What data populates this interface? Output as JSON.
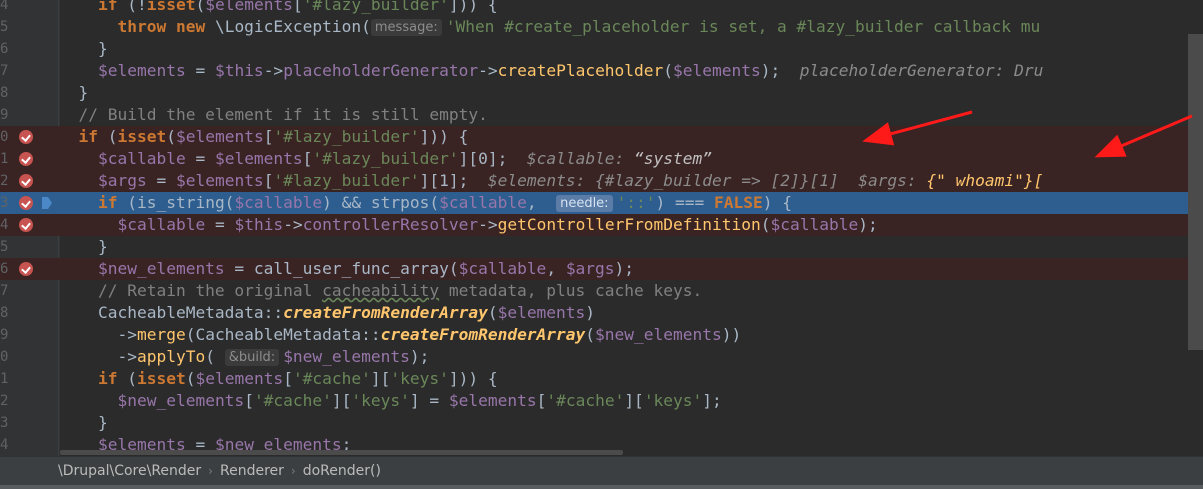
{
  "editor": {
    "lines": [
      {
        "num": "4",
        "bp": false,
        "cur": false,
        "tokens": [
          {
            "c": "com",
            "t": "    "
          },
          {
            "c": "kw",
            "t": "if"
          },
          {
            "c": "",
            "t": " (!"
          },
          {
            "c": "kw",
            "t": "isset"
          },
          {
            "c": "",
            "t": "("
          },
          {
            "c": "var",
            "t": "$elements"
          },
          {
            "c": "",
            "t": "["
          },
          {
            "c": "str",
            "t": "'#lazy_builder'"
          },
          {
            "c": "",
            "t": "])) {"
          }
        ]
      },
      {
        "num": "5",
        "bp": false,
        "cur": false,
        "tokens": [
          {
            "c": "",
            "t": "      "
          },
          {
            "c": "kw",
            "t": "throw new"
          },
          {
            "c": "",
            "t": " \\LogicException("
          },
          {
            "c": "hint",
            "t": "message:"
          },
          {
            "c": "str",
            "t": "'When #create_placeholder is set, a #lazy_builder callback mu"
          }
        ]
      },
      {
        "num": "6",
        "bp": false,
        "cur": false,
        "tokens": [
          {
            "c": "",
            "t": "    }"
          }
        ]
      },
      {
        "num": "7",
        "bp": false,
        "cur": false,
        "tokens": [
          {
            "c": "",
            "t": "    "
          },
          {
            "c": "var",
            "t": "$elements"
          },
          {
            "c": "",
            "t": " = "
          },
          {
            "c": "var",
            "t": "$this"
          },
          {
            "c": "",
            "t": "->"
          },
          {
            "c": "var",
            "t": "placeholderGenerator"
          },
          {
            "c": "",
            "t": "->"
          },
          {
            "c": "fn",
            "t": "createPlaceholder"
          },
          {
            "c": "",
            "t": "("
          },
          {
            "c": "var",
            "t": "$elements"
          },
          {
            "c": "",
            "t": ");  "
          },
          {
            "c": "dbg",
            "t": "placeholderGenerator: Dru"
          }
        ]
      },
      {
        "num": "8",
        "bp": false,
        "cur": false,
        "tokens": [
          {
            "c": "",
            "t": "  }"
          }
        ]
      },
      {
        "num": "9",
        "bp": false,
        "cur": false,
        "tokens": [
          {
            "c": "com",
            "t": "  // Build the element if it is still empty."
          }
        ]
      },
      {
        "num": "0",
        "bp": true,
        "cur": false,
        "tokens": [
          {
            "c": "",
            "t": "  "
          },
          {
            "c": "kw",
            "t": "if"
          },
          {
            "c": "",
            "t": " ("
          },
          {
            "c": "kw",
            "t": "isset"
          },
          {
            "c": "",
            "t": "("
          },
          {
            "c": "var",
            "t": "$elements"
          },
          {
            "c": "",
            "t": "["
          },
          {
            "c": "str",
            "t": "'#lazy_builder'"
          },
          {
            "c": "",
            "t": "])) {"
          }
        ]
      },
      {
        "num": "1",
        "bp": true,
        "cur": false,
        "tokens": [
          {
            "c": "",
            "t": "    "
          },
          {
            "c": "var",
            "t": "$callable"
          },
          {
            "c": "",
            "t": " = "
          },
          {
            "c": "var",
            "t": "$elements"
          },
          {
            "c": "",
            "t": "["
          },
          {
            "c": "str",
            "t": "'#lazy_builder'"
          },
          {
            "c": "",
            "t": "][0];  "
          },
          {
            "c": "dbg",
            "t": "$callable: "
          },
          {
            "c": "dbgv",
            "t": "“system”"
          }
        ]
      },
      {
        "num": "2",
        "bp": true,
        "cur": false,
        "tokens": [
          {
            "c": "",
            "t": "    "
          },
          {
            "c": "var",
            "t": "$args"
          },
          {
            "c": "",
            "t": " = "
          },
          {
            "c": "var",
            "t": "$elements"
          },
          {
            "c": "",
            "t": "["
          },
          {
            "c": "str",
            "t": "'#lazy_builder'"
          },
          {
            "c": "",
            "t": "][1];  "
          },
          {
            "c": "dbg",
            "t": "$elements: {#lazy_builder => [2]}[1]  $args: "
          },
          {
            "c": "dbgo",
            "t": "{\" whoami\"}["
          }
        ]
      },
      {
        "num": "3",
        "bp": true,
        "cur": true,
        "tokens": [
          {
            "c": "",
            "t": "    "
          },
          {
            "c": "kw",
            "t": "if"
          },
          {
            "c": "",
            "t": " (is_string("
          },
          {
            "c": "var",
            "t": "$callable"
          },
          {
            "c": "",
            "t": ") && strpos("
          },
          {
            "c": "var",
            "t": "$callable"
          },
          {
            "c": "",
            "t": ",  "
          },
          {
            "c": "hint",
            "t": "needle:"
          },
          {
            "c": "str",
            "t": "'::'"
          },
          {
            "c": "",
            "t": ") === "
          },
          {
            "c": "kw",
            "t": "FALSE"
          },
          {
            "c": "",
            "t": ") {"
          }
        ]
      },
      {
        "num": "4",
        "bp": true,
        "cur": false,
        "tokens": [
          {
            "c": "",
            "t": "      "
          },
          {
            "c": "var",
            "t": "$callable"
          },
          {
            "c": "",
            "t": " = "
          },
          {
            "c": "var",
            "t": "$this"
          },
          {
            "c": "",
            "t": "->"
          },
          {
            "c": "var",
            "t": "controllerResolver"
          },
          {
            "c": "",
            "t": "->"
          },
          {
            "c": "fn",
            "t": "getControllerFromDefinition"
          },
          {
            "c": "",
            "t": "("
          },
          {
            "c": "var",
            "t": "$callable"
          },
          {
            "c": "",
            "t": ");"
          }
        ]
      },
      {
        "num": "5",
        "bp": false,
        "cur": false,
        "tokens": [
          {
            "c": "",
            "t": "    }"
          }
        ]
      },
      {
        "num": "6",
        "bp": true,
        "cur": false,
        "tokens": [
          {
            "c": "",
            "t": "    "
          },
          {
            "c": "var",
            "t": "$new_elements"
          },
          {
            "c": "",
            "t": " = call_user_func_array("
          },
          {
            "c": "var",
            "t": "$callable"
          },
          {
            "c": "",
            "t": ", "
          },
          {
            "c": "var",
            "t": "$args"
          },
          {
            "c": "",
            "t": ");"
          }
        ]
      },
      {
        "num": "7",
        "bp": false,
        "cur": false,
        "tokens": [
          {
            "c": "com",
            "t": "    // Retain the original "
          },
          {
            "c": "com squig",
            "t": "cacheability"
          },
          {
            "c": "com",
            "t": " metadata, plus cache keys."
          }
        ]
      },
      {
        "num": "8",
        "bp": false,
        "cur": false,
        "tokens": [
          {
            "c": "",
            "t": "    CacheableMetadata::"
          },
          {
            "c": "sfn",
            "t": "createFromRenderArray"
          },
          {
            "c": "",
            "t": "("
          },
          {
            "c": "var",
            "t": "$elements"
          },
          {
            "c": "",
            "t": ")"
          }
        ]
      },
      {
        "num": "9",
        "bp": false,
        "cur": false,
        "tokens": [
          {
            "c": "",
            "t": "      ->"
          },
          {
            "c": "fn",
            "t": "merge"
          },
          {
            "c": "",
            "t": "(CacheableMetadata::"
          },
          {
            "c": "sfn",
            "t": "createFromRenderArray"
          },
          {
            "c": "",
            "t": "("
          },
          {
            "c": "var",
            "t": "$new_elements"
          },
          {
            "c": "",
            "t": "))"
          }
        ]
      },
      {
        "num": "0",
        "bp": false,
        "cur": false,
        "tokens": [
          {
            "c": "",
            "t": "      ->"
          },
          {
            "c": "fn",
            "t": "applyTo"
          },
          {
            "c": "",
            "t": "( "
          },
          {
            "c": "hint",
            "t": "&build:"
          },
          {
            "c": "var",
            "t": "$new_elements"
          },
          {
            "c": "",
            "t": ");"
          }
        ]
      },
      {
        "num": "1",
        "bp": false,
        "cur": false,
        "tokens": [
          {
            "c": "",
            "t": "    "
          },
          {
            "c": "kw",
            "t": "if"
          },
          {
            "c": "",
            "t": " ("
          },
          {
            "c": "kw",
            "t": "isset"
          },
          {
            "c": "",
            "t": "("
          },
          {
            "c": "var",
            "t": "$elements"
          },
          {
            "c": "",
            "t": "["
          },
          {
            "c": "str",
            "t": "'#cache'"
          },
          {
            "c": "",
            "t": "]["
          },
          {
            "c": "str",
            "t": "'keys'"
          },
          {
            "c": "",
            "t": "])) {"
          }
        ]
      },
      {
        "num": "2",
        "bp": false,
        "cur": false,
        "tokens": [
          {
            "c": "",
            "t": "      "
          },
          {
            "c": "var",
            "t": "$new_elements"
          },
          {
            "c": "",
            "t": "["
          },
          {
            "c": "str",
            "t": "'#cache'"
          },
          {
            "c": "",
            "t": "]["
          },
          {
            "c": "str",
            "t": "'keys'"
          },
          {
            "c": "",
            "t": "] = "
          },
          {
            "c": "var",
            "t": "$elements"
          },
          {
            "c": "",
            "t": "["
          },
          {
            "c": "str",
            "t": "'#cache'"
          },
          {
            "c": "",
            "t": "]["
          },
          {
            "c": "str",
            "t": "'keys'"
          },
          {
            "c": "",
            "t": "];"
          }
        ]
      },
      {
        "num": "3",
        "bp": false,
        "cur": false,
        "tokens": [
          {
            "c": "",
            "t": "    }"
          }
        ]
      },
      {
        "num": "4",
        "bp": false,
        "cur": false,
        "tokens": [
          {
            "c": "",
            "t": "    "
          },
          {
            "c": "var",
            "t": "$elements"
          },
          {
            "c": "",
            "t": " = "
          },
          {
            "c": "var",
            "t": "$new_elements"
          },
          {
            "c": "",
            "t": ";"
          }
        ]
      }
    ]
  },
  "colors": {
    "background": "#2b2b2b",
    "breakpoint_line": "#3a2323",
    "current_line": "#2d5e8f",
    "breakpoint_icon": "#c75450",
    "annotation_arrow": "#ff1a1a"
  },
  "breadcrumb": {
    "items": [
      "\\Drupal\\Core\\Render",
      "Renderer",
      "doRender()"
    ],
    "separator": "›"
  }
}
